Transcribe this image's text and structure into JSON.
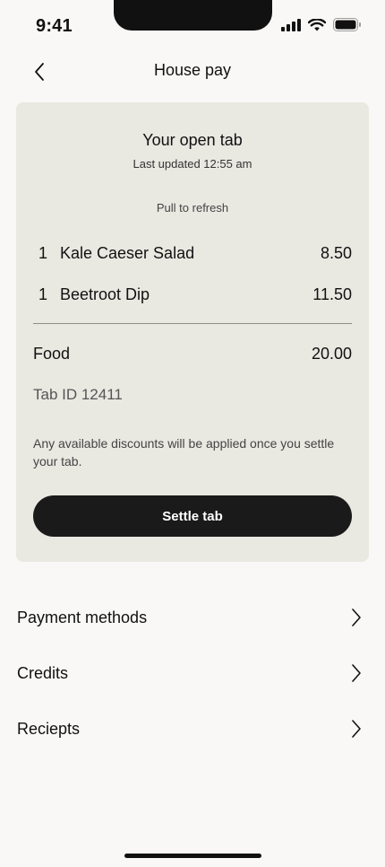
{
  "status_bar": {
    "time": "9:41"
  },
  "header": {
    "title": "House pay"
  },
  "tab": {
    "title": "Your open tab",
    "last_updated": "Last updated 12:55 am",
    "pull_hint": "Pull to refresh",
    "items": [
      {
        "qty": "1",
        "name": "Kale Caeser Salad",
        "price": "8.50"
      },
      {
        "qty": "1",
        "name": "Beetroot Dip",
        "price": "11.50"
      }
    ],
    "food_label": "Food",
    "food_total": "20.00",
    "tab_id": "Tab ID 12411",
    "discount_note": "Any available discounts will be applied once you settle your tab.",
    "settle_label": "Settle tab"
  },
  "menu": [
    {
      "label": "Payment methods"
    },
    {
      "label": "Credits"
    },
    {
      "label": "Reciepts"
    }
  ]
}
